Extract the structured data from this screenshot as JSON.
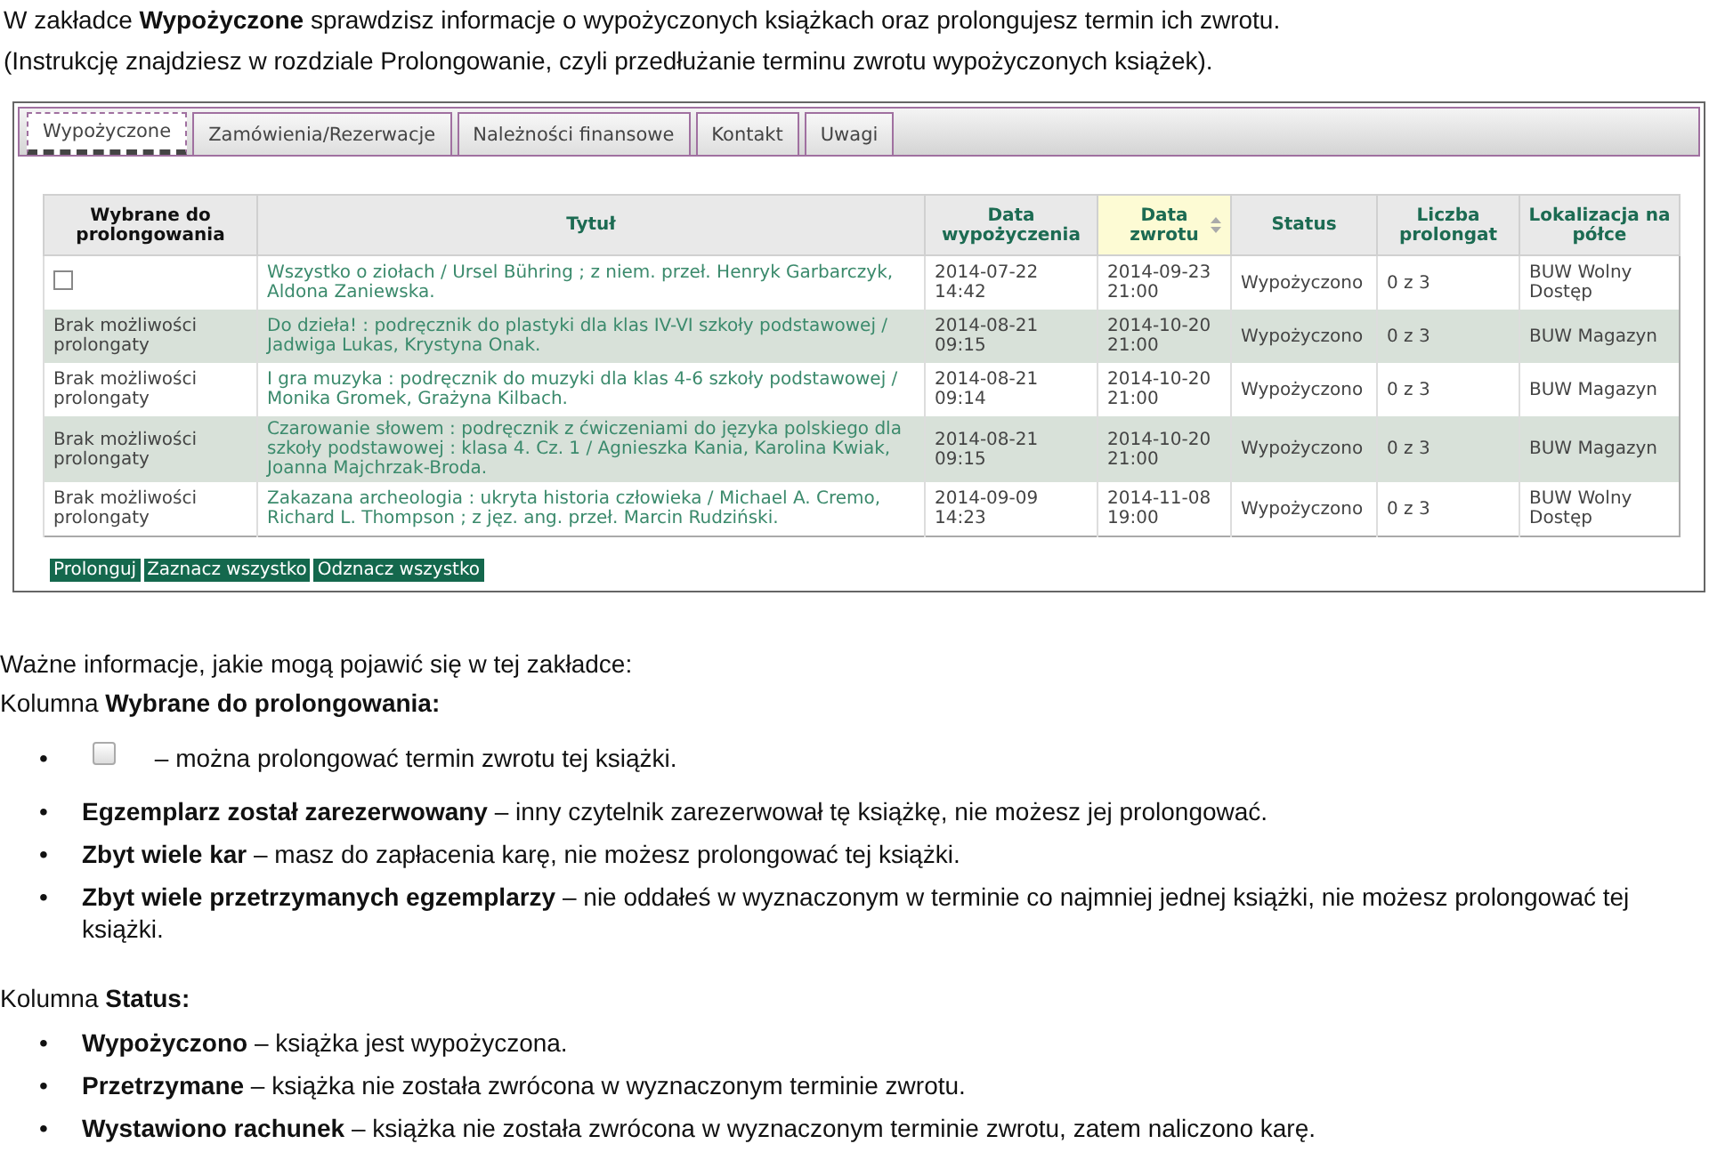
{
  "intro": [
    "W zakładce **Wypożyczone** sprawdzisz informacje o wypożyczonych książkach oraz prolongujesz termin ich zwrotu.",
    "(Instrukcję znajdziesz w rozdziale Prolongowanie, czyli przedłużanie terminu zwrotu wypożyczonych książek)."
  ],
  "tabs": [
    {
      "label": "Wypożyczone",
      "selected": true
    },
    {
      "label": "Zamówienia/Rezerwacje",
      "selected": false
    },
    {
      "label": "Należności finansowe",
      "selected": false
    },
    {
      "label": "Kontakt",
      "selected": false
    },
    {
      "label": "Uwagi",
      "selected": false
    }
  ],
  "table": {
    "columns": [
      {
        "label": "Wybrane do prolongowania",
        "sorted": false
      },
      {
        "label": "Tytuł",
        "sorted": false
      },
      {
        "label": "Data wypożyczenia",
        "sorted": false
      },
      {
        "label": "Data zwrotu",
        "sorted": true
      },
      {
        "label": "Status",
        "sorted": false
      },
      {
        "label": "Liczba prolongat",
        "sorted": false
      },
      {
        "label": "Lokalizacja na półce",
        "sorted": false
      }
    ],
    "rows": [
      {
        "kind": "checkbox",
        "checked": false,
        "title": "Wszystko o ziołach / Ursel Bühring ; z niem. przeł. Henryk Garbarczyk, Aldona Zaniewska.",
        "loaned": "2014-07-22 14:42",
        "due": "2014-09-23 21:00",
        "status": "Wypożyczono",
        "renewals": "0 z 3",
        "location": "BUW Wolny Dostęp"
      },
      {
        "kind": "text",
        "note": "Brak możliwości prolongaty",
        "title": "Do dzieła! : podręcznik do plastyki dla klas IV-VI szkoły podstawowej / Jadwiga Lukas, Krystyna Onak.",
        "loaned": "2014-08-21 09:15",
        "due": "2014-10-20 21:00",
        "status": "Wypożyczono",
        "renewals": "0 z 3",
        "location": "BUW Magazyn"
      },
      {
        "kind": "text",
        "note": "Brak możliwości prolongaty",
        "title": "I gra muzyka : podręcznik do muzyki dla klas 4-6 szkoły podstawowej / Monika Gromek, Grażyna Kilbach.",
        "loaned": "2014-08-21 09:14",
        "due": "2014-10-20 21:00",
        "status": "Wypożyczono",
        "renewals": "0 z 3",
        "location": "BUW Magazyn"
      },
      {
        "kind": "text",
        "note": "Brak możliwości prolongaty",
        "title": "Czarowanie słowem : podręcznik z ćwiczeniami do języka polskiego dla szkoły podstawowej : klasa 4. Cz. 1 / Agnieszka Kania, Karolina Kwiak, Joanna Majchrzak-Broda.",
        "loaned": "2014-08-21 09:15",
        "due": "2014-10-20 21:00",
        "status": "Wypożyczono",
        "renewals": "0 z 3",
        "location": "BUW Magazyn"
      },
      {
        "kind": "text",
        "note": "Brak możliwości prolongaty",
        "title": "Zakazana archeologia : ukryta historia człowieka / Michael A. Cremo, Richard L. Thompson ; z jęz. ang. przeł. Marcin Rudziński.",
        "loaned": "2014-09-09 14:23",
        "due": "2014-11-08 19:00",
        "status": "Wypożyczono",
        "renewals": "0 z 3",
        "location": "BUW Wolny Dostęp"
      }
    ]
  },
  "buttons": [
    "Prolonguj",
    "Zaznacz wszystko",
    "Odznacz wszystko"
  ],
  "notes_heading": "Ważne informacje, jakie mogą pojawić się w tej zakładce:",
  "sections": [
    {
      "heading": "Kolumna **Wybrane do prolongowania:**",
      "items": [
        {
          "kind": "checkbox",
          "bullet": "•",
          "text": "– można prolongować termin zwrotu tej książki."
        },
        {
          "kind": "text",
          "bullet": "•",
          "text": "**Egzemplarz został zarezerwowany** – inny czytelnik zarezerwował tę książkę, nie możesz jej prolongować."
        },
        {
          "kind": "text",
          "bullet": "•",
          "text": "**Zbyt wiele kar** – masz do zapłacenia karę, nie możesz prolongować tej książki."
        },
        {
          "kind": "text",
          "bullet": "•",
          "text": "**Zbyt wiele przetrzymanych egzemplarzy** – nie oddałeś w wyznaczonym w terminie co najmniej jednej książki, nie możesz prolongować tej książki."
        }
      ]
    },
    {
      "heading": "Kolumna **Status:**",
      "items": [
        {
          "kind": "text",
          "bullet": "•",
          "text": "**Wypożyczono** – książka jest wypożyczona."
        },
        {
          "kind": "text",
          "bullet": "•",
          "text": "**Przetrzymane** – książka nie została zwrócona w wyznaczonym terminie zwrotu."
        },
        {
          "kind": "text",
          "bullet": "•",
          "text": "**Wystawiono rachunek** – książka nie została zwrócona w wyznaczonym terminie zwrotu, zatem naliczono karę."
        }
      ]
    }
  ]
}
